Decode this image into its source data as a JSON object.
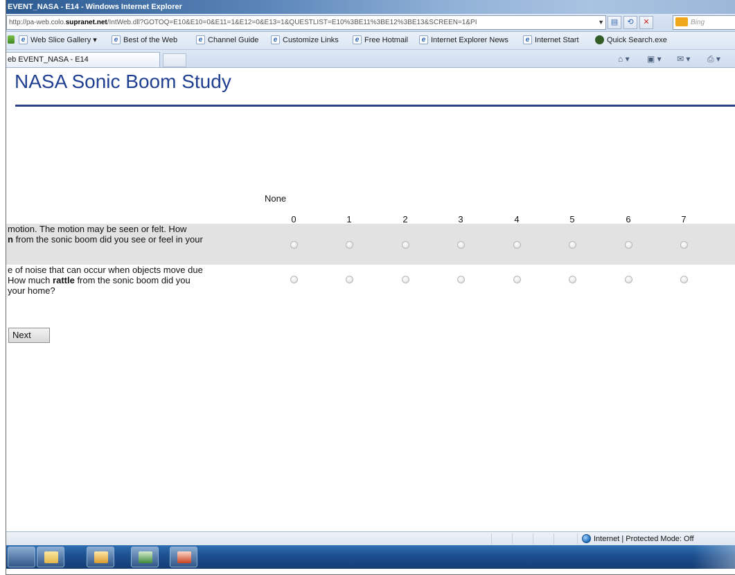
{
  "window": {
    "title": "EVENT_NASA - E14 - Windows Internet Explorer"
  },
  "address_bar": {
    "url_prefix": "http://pa-web.colo.",
    "url_domain": "supranet.net",
    "url_rest": "/IntWeb.dll?GOTOQ=E10&E10=0&E11=1&E12=0&E13=1&QUESTLIST=E10%3BE11%3BE12%3BE13&SCREEN=1&PI",
    "search_placeholder": "Bing"
  },
  "favorites": [
    {
      "label": "Web Slice Gallery ▾",
      "icon": "ie-icon"
    },
    {
      "label": "Best of the Web",
      "icon": "ie-icon"
    },
    {
      "label": "Channel Guide",
      "icon": "ie-icon"
    },
    {
      "label": "Customize Links",
      "icon": "ie-icon"
    },
    {
      "label": "Free Hotmail",
      "icon": "ie-icon"
    },
    {
      "label": "Internet Explorer News",
      "icon": "ie-icon"
    },
    {
      "label": "Internet Start",
      "icon": "ie-icon"
    },
    {
      "label": "Quick Search.exe",
      "icon": "search-icon"
    }
  ],
  "tab": {
    "label": "eb EVENT_NASA - E14"
  },
  "page": {
    "title": "NASA Sonic Boom Study",
    "scale_anchor_label": "None",
    "scale_values": [
      "0",
      "1",
      "2",
      "3",
      "4",
      "5",
      "6",
      "7"
    ],
    "questions": [
      {
        "line1": "motion. The motion may be seen or felt. How",
        "line2_bold": "n",
        "line2_rest": " from the sonic boom did you see or feel in your"
      },
      {
        "line1": "e of noise that can occur when objects move due",
        "line2_pre": "How much ",
        "line2_bold": "rattle",
        "line2_rest": " from the sonic boom did you",
        "line3": "your home?"
      }
    ],
    "next_label": "Next"
  },
  "status_bar": {
    "zone_text": "Internet | Protected Mode: Off"
  },
  "colors": {
    "title_blue": "#1f3f92",
    "rule_blue": "#2e3f8c",
    "row_shade": "#e2e2e2",
    "taskbar": "#1c4f8f"
  }
}
